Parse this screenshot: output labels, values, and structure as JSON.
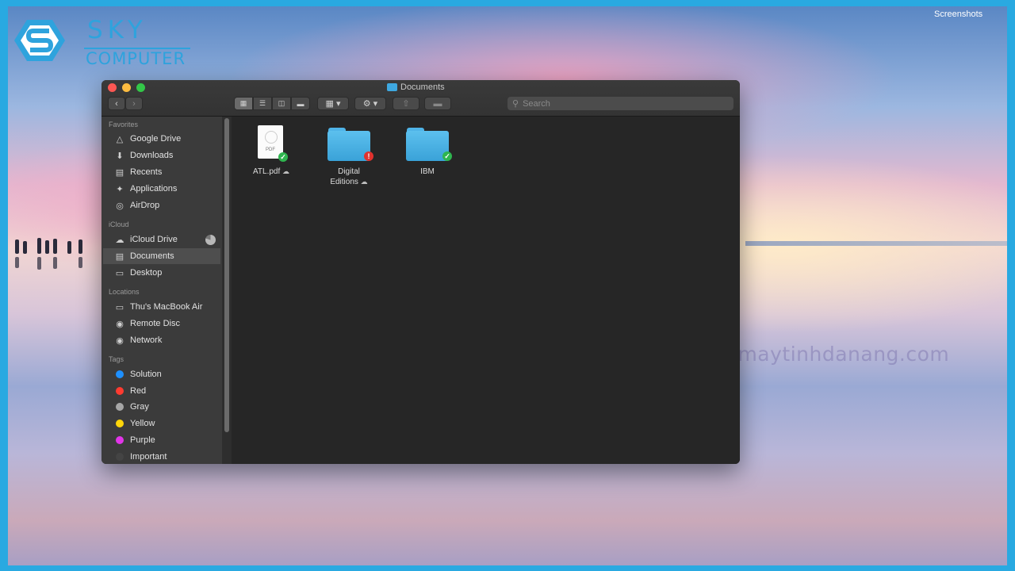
{
  "logo": {
    "word1": "SKY",
    "word2": "COMPUTER"
  },
  "screen_label": "Screenshots",
  "watermark": "suachuamaytinhdanang.com",
  "window": {
    "title": "Documents",
    "search_placeholder": "Search"
  },
  "sidebar": {
    "sections": [
      {
        "header": "Favorites",
        "items": [
          {
            "label": "Google Drive",
            "icon": "google-drive-icon"
          },
          {
            "label": "Downloads",
            "icon": "downloads-icon"
          },
          {
            "label": "Recents",
            "icon": "recents-icon"
          },
          {
            "label": "Applications",
            "icon": "applications-icon"
          },
          {
            "label": "AirDrop",
            "icon": "airdrop-icon"
          }
        ]
      },
      {
        "header": "iCloud",
        "items": [
          {
            "label": "iCloud Drive",
            "icon": "icloud-icon"
          },
          {
            "label": "Documents",
            "icon": "documents-icon",
            "selected": true
          },
          {
            "label": "Desktop",
            "icon": "desktop-icon"
          }
        ]
      },
      {
        "header": "Locations",
        "items": [
          {
            "label": "Thu's MacBook Air",
            "icon": "laptop-icon"
          },
          {
            "label": "Remote Disc",
            "icon": "disc-icon"
          },
          {
            "label": "Network",
            "icon": "network-icon"
          }
        ]
      },
      {
        "header": "Tags",
        "items": [
          {
            "label": "Solution",
            "color": "#1e90ff"
          },
          {
            "label": "Red",
            "color": "#ff3b30"
          },
          {
            "label": "Gray",
            "color": "#a6a6a6"
          },
          {
            "label": "Yellow",
            "color": "#ffd60a"
          },
          {
            "label": "Purple",
            "color": "#e135e8"
          },
          {
            "label": "Important",
            "color": "#444444"
          }
        ]
      }
    ]
  },
  "files": [
    {
      "label": "ATL.pdf",
      "type": "pdf",
      "badge": "synced",
      "cloud": true
    },
    {
      "label": "Digital Editions",
      "type": "folder",
      "badge": "error",
      "cloud": true
    },
    {
      "label": "IBM",
      "type": "folder",
      "badge": "synced",
      "cloud": false
    }
  ],
  "colors": {
    "frame": "#29a9e1",
    "folder": "#3ea8e0",
    "sync_ok": "#2fb54f",
    "sync_error": "#e0322e"
  }
}
